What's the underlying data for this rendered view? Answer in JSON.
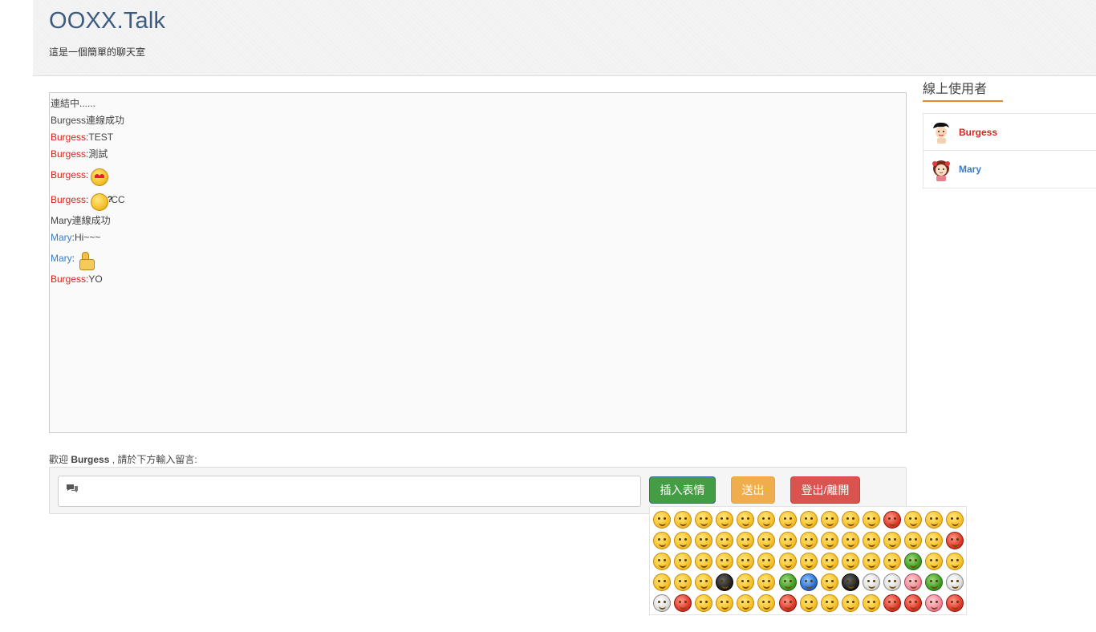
{
  "header": {
    "title": "OOXX.Talk",
    "subtitle": "這是一個簡單的聊天室"
  },
  "chat": {
    "messages": [
      {
        "text": "連結中......"
      },
      {
        "text": "Burgess連線成功"
      },
      {
        "sender": "Burgess",
        "sep": " : ",
        "text": "TEST",
        "color": "#d9231c"
      },
      {
        "sender": "Burgess",
        "sep": " : ",
        "text": "測試",
        "color": "#d9231c"
      },
      {
        "sender": "Burgess",
        "sep": " : ",
        "emoji": "heart-eyes-emoji",
        "color": "#d9231c"
      },
      {
        "sender": "Burgess",
        "sep": " : ",
        "emoji": "thinking-emoji",
        "text": "CC",
        "color": "#d9231c"
      },
      {
        "text": "Mary連線成功"
      },
      {
        "sender": "Mary",
        "sep": " : ",
        "text": "Hi~~~",
        "color": "#3a7cc3"
      },
      {
        "sender": "Mary",
        "sep": " : ",
        "emoji": "thumbs-up-emoji",
        "color": "#3a7cc3"
      },
      {
        "sender": "Burgess",
        "sep": " : ",
        "text": "YO",
        "color": "#d9231c"
      }
    ]
  },
  "welcome": {
    "prefix": "歡迎 ",
    "user": "Burgess",
    "suffix": " , 請於下方輸入留言:"
  },
  "composer": {
    "input_value": "",
    "icon": "chat-bubbles-icon",
    "emoji_button": "插入表情",
    "send_button": "送出",
    "logout_button": "登出/離開"
  },
  "emoji_picker": {
    "count": 75,
    "colors": {
      "special": {
        "11": "c-red",
        "29": "c-red",
        "42": "c-green",
        "48": "c-dark",
        "51": "c-green",
        "52": "c-blue",
        "54": "c-dark",
        "55": "c-white",
        "56": "c-white",
        "57": "c-pink",
        "58": "c-green",
        "59": "c-white",
        "60": "c-white",
        "61": "c-red",
        "66": "c-red",
        "71": "c-red",
        "72": "c-red",
        "73": "c-pink",
        "74": "c-red"
      }
    }
  },
  "sidebar": {
    "title": "線上使用者",
    "users": [
      {
        "name": "Burgess",
        "color": "#d9231c",
        "avatar": "boy-avatar-icon"
      },
      {
        "name": "Mary",
        "color": "#3a7cc3",
        "avatar": "girl-avatar-icon"
      }
    ]
  },
  "colors": {
    "brand": "#3d5a80",
    "success": "#449d44",
    "warning": "#f0ad4e",
    "danger": "#d9534f",
    "accent_underline": "#e8862b"
  }
}
